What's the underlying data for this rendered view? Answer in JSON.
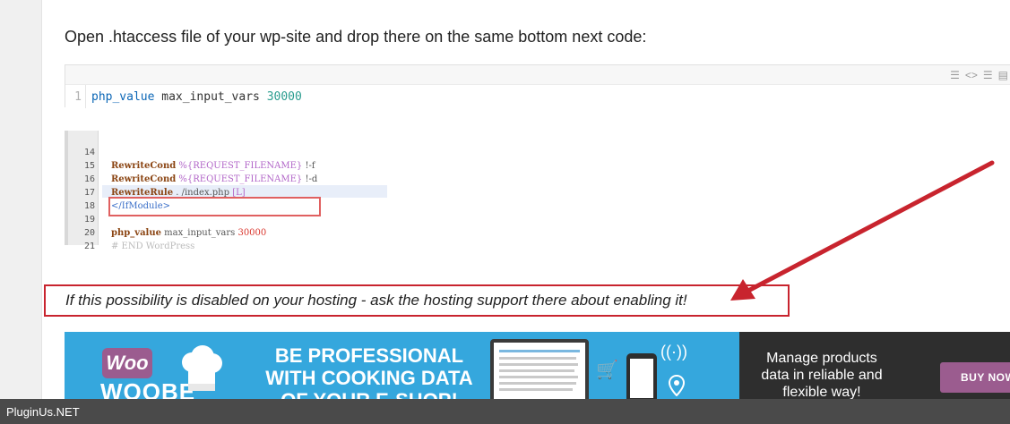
{
  "intro": "Open .htaccess file of your wp-site and drop there on the same bottom next code:",
  "code_block": {
    "line_number": "1",
    "keyword": "php_value",
    "text": " max_input_vars ",
    "number": "30000",
    "toolbar_icons": [
      "menu-icon",
      "code-icon",
      "list-icon",
      "copy-icon"
    ]
  },
  "code_screenshot": {
    "rows": [
      {
        "n": "14",
        "dir": "RewriteCond",
        "var": " %{REQUEST_FILENAME}",
        "rest": " !-f"
      },
      {
        "n": "15",
        "dir": "RewriteCond",
        "var": " %{REQUEST_FILENAME}",
        "rest": " !-d"
      },
      {
        "n": "16",
        "dir": "RewriteRule",
        "var": "",
        "rest": " . /index.php ",
        "extra": "[L]"
      },
      {
        "n": "17",
        "tag": "</IfModule>"
      },
      {
        "n": "18"
      },
      {
        "n": "19",
        "dir": "php_value",
        "rest": " max_input_vars ",
        "red": "30000"
      },
      {
        "n": "20",
        "cmt": "# END WordPress"
      },
      {
        "n": "21"
      }
    ]
  },
  "notice": "If this possibility is disabled on your hosting - ask the hosting support there about enabling it!",
  "banner": {
    "woo": "Woo",
    "woobe": "WOOBE",
    "headline": [
      "BE PROFESSIONAL",
      "WITH COOKING DATA",
      "OF YOUR E-SHOP!"
    ],
    "manage": [
      "Manage products",
      "data in reliable and",
      "flexible way!"
    ],
    "buy": "BUY NOW",
    "colors": {
      "blue": "#35a7dd",
      "dark": "#2e2e2e",
      "purple": "#9b5c8f"
    }
  },
  "footer": "PluginUs.NET",
  "colors": {
    "notice_border": "#c8242e",
    "arrow": "#c8242e"
  }
}
